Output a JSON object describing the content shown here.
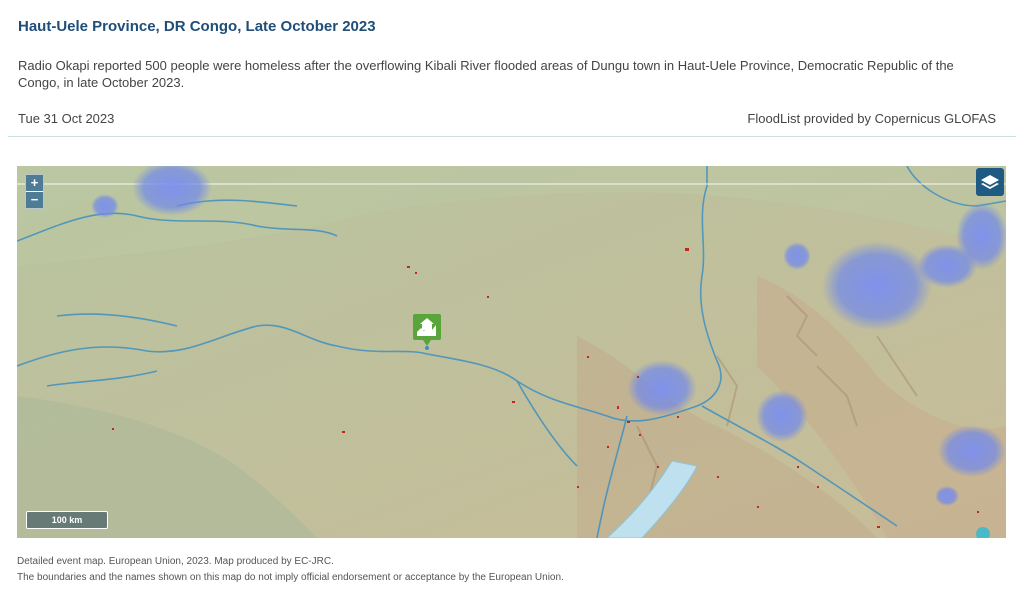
{
  "event": {
    "title": "Haut-Uele Province, DR Congo, Late October 2023",
    "description": "Radio Okapi reported 500 people were homeless after the overflowing Kibali River flooded areas of Dungu town in Haut-Uele Province, Democratic Republic of the Congo, in late October 2023.",
    "date": "Tue 31 Oct 2023",
    "credit": "FloodList provided by Copernicus GLOFAS"
  },
  "map": {
    "zoom_in_label": "+",
    "zoom_out_label": "−",
    "scale_label": "100 km",
    "layers_icon": "layers-icon",
    "marker_icon": "flood-house-icon",
    "colors": {
      "terrain": "#cdbf9d",
      "rivers": "#3f8fc1",
      "rain": "#6f86e8",
      "marker": "#59a53c",
      "lake": "#bfe0ee"
    }
  },
  "captions": {
    "line1": "Detailed event map. European Union, 2023. Map produced by EC-JRC.",
    "line2": "The boundaries and the names shown on this map do not imply official endorsement or acceptance by the European Union."
  }
}
